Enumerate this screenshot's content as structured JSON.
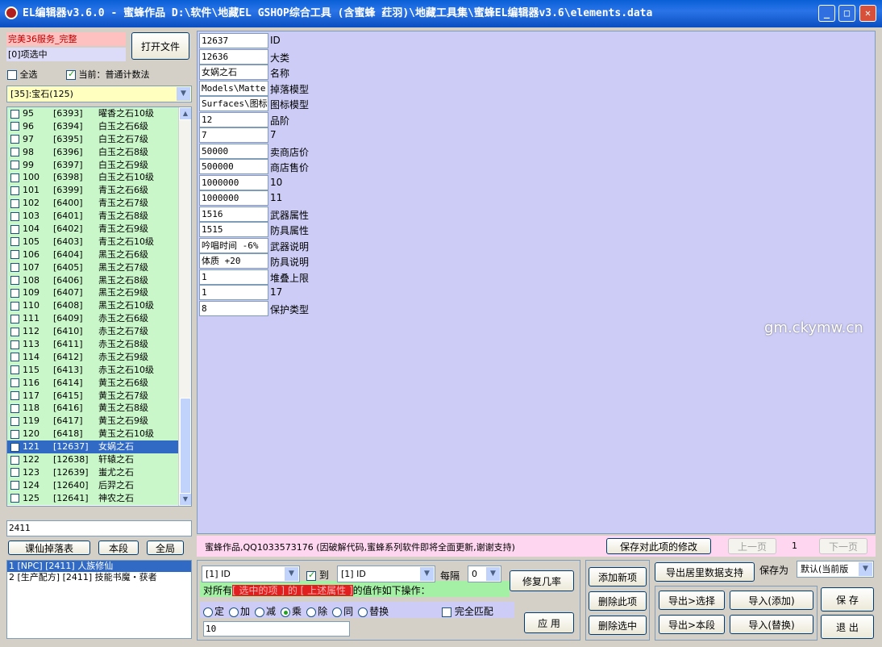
{
  "window": {
    "title": "EL编辑器v3.6.0  -  蜜蜂作品  D:\\软件\\地藏EL GSHOP综合工具 (含蜜蜂 荭羽)\\地藏工具集\\蜜蜂EL编辑器v3.6\\elements.data"
  },
  "left": {
    "server_label": "完美36服务_完整",
    "selected_count": "[0]项选中",
    "open_button": "打开文件",
    "select_all": "全选",
    "current_label": "当前：普通计数法",
    "category": "[35]:宝石(125)",
    "items": [
      {
        "n": "95",
        "id": "[6393]",
        "name": "曜香之石10级",
        "sel": false
      },
      {
        "n": "96",
        "id": "[6394]",
        "name": "白玉之石6级",
        "sel": false
      },
      {
        "n": "97",
        "id": "[6395]",
        "name": "白玉之石7级",
        "sel": false
      },
      {
        "n": "98",
        "id": "[6396]",
        "name": "白玉之石8级",
        "sel": false
      },
      {
        "n": "99",
        "id": "[6397]",
        "name": "白玉之石9级",
        "sel": false
      },
      {
        "n": "100",
        "id": "[6398]",
        "name": "白玉之石10级",
        "sel": false
      },
      {
        "n": "101",
        "id": "[6399]",
        "name": "青玉之石6级",
        "sel": false
      },
      {
        "n": "102",
        "id": "[6400]",
        "name": "青玉之石7级",
        "sel": false
      },
      {
        "n": "103",
        "id": "[6401]",
        "name": "青玉之石8级",
        "sel": false
      },
      {
        "n": "104",
        "id": "[6402]",
        "name": "青玉之石9级",
        "sel": false
      },
      {
        "n": "105",
        "id": "[6403]",
        "name": "青玉之石10级",
        "sel": false
      },
      {
        "n": "106",
        "id": "[6404]",
        "name": "黑玉之石6级",
        "sel": false
      },
      {
        "n": "107",
        "id": "[6405]",
        "name": "黑玉之石7级",
        "sel": false
      },
      {
        "n": "108",
        "id": "[6406]",
        "name": "黑玉之石8级",
        "sel": false
      },
      {
        "n": "109",
        "id": "[6407]",
        "name": "黑玉之石9级",
        "sel": false
      },
      {
        "n": "110",
        "id": "[6408]",
        "name": "黑玉之石10级",
        "sel": false
      },
      {
        "n": "111",
        "id": "[6409]",
        "name": "赤玉之石6级",
        "sel": false
      },
      {
        "n": "112",
        "id": "[6410]",
        "name": "赤玉之石7级",
        "sel": false
      },
      {
        "n": "113",
        "id": "[6411]",
        "name": "赤玉之石8级",
        "sel": false
      },
      {
        "n": "114",
        "id": "[6412]",
        "name": "赤玉之石9级",
        "sel": false
      },
      {
        "n": "115",
        "id": "[6413]",
        "name": "赤玉之石10级",
        "sel": false
      },
      {
        "n": "116",
        "id": "[6414]",
        "name": "黄玉之石6级",
        "sel": false
      },
      {
        "n": "117",
        "id": "[6415]",
        "name": "黄玉之石7级",
        "sel": false
      },
      {
        "n": "118",
        "id": "[6416]",
        "name": "黄玉之石8级",
        "sel": false
      },
      {
        "n": "119",
        "id": "[6417]",
        "name": "黄玉之石9级",
        "sel": false
      },
      {
        "n": "120",
        "id": "[6418]",
        "name": "黄玉之石10级",
        "sel": false
      },
      {
        "n": "121",
        "id": "[12637]",
        "name": "女娲之石",
        "sel": true
      },
      {
        "n": "122",
        "id": "[12638]",
        "name": "轩辕之石",
        "sel": false
      },
      {
        "n": "123",
        "id": "[12639]",
        "name": "蚩尤之石",
        "sel": false
      },
      {
        "n": "124",
        "id": "[12640]",
        "name": "后羿之石",
        "sel": false
      },
      {
        "n": "125",
        "id": "[12641]",
        "name": "神农之石",
        "sel": false
      }
    ],
    "search_value": "2411",
    "btn_drop": "课仙掉落表",
    "btn_section": "本段",
    "btn_all": "全局",
    "results": [
      "1 [NPC] [2411] 人族修仙",
      "2 [生产配方] [2411] 技能书魔・获者"
    ]
  },
  "fields": [
    {
      "value": "12637",
      "label": "ID"
    },
    {
      "value": "12636",
      "label": "大类"
    },
    {
      "value": "女娲之石",
      "label": "名称"
    },
    {
      "value": "Models\\Matte",
      "label": "掉落模型"
    },
    {
      "value": "Surfaces\\图标",
      "label": "图标模型"
    },
    {
      "value": "12",
      "label": "品阶"
    },
    {
      "value": "7",
      "label": "7"
    },
    {
      "value": "50000",
      "label": "卖商店价"
    },
    {
      "value": "500000",
      "label": "商店售价"
    },
    {
      "value": "1000000",
      "label": "10"
    },
    {
      "value": "1000000",
      "label": "11"
    },
    {
      "value": "1516",
      "label": "武器属性"
    },
    {
      "value": "1515",
      "label": "防具属性"
    },
    {
      "value": "吟唱时间 -6%",
      "label": "武器说明"
    },
    {
      "value": "体质 +20",
      "label": "防具说明"
    },
    {
      "value": "1",
      "label": "堆叠上限"
    },
    {
      "value": "1",
      "label": "17"
    },
    {
      "value": "8",
      "label": "保护类型"
    }
  ],
  "status": {
    "message": "蜜蜂作品,QQ1033573176 (因破解代码,蜜蜂系列软件即将全面更新,谢谢支持)",
    "save_item": "保存对此项的修改",
    "prev": "上一页",
    "page": "1",
    "next": "下一页"
  },
  "bottom": {
    "from_field": "[1] ID",
    "to_label": "到",
    "to_field": "[1] ID",
    "interval_label": "每隔",
    "interval_value": "0",
    "restore_btn": "修复几率",
    "text_prefix": "对所有",
    "highlight": "[ 选中的项 ] 的 [ 上述属性 ]",
    "text_suffix": "的值作如下操作：",
    "ops": [
      "定",
      "加",
      "减",
      "乘",
      "除",
      "同",
      "替换"
    ],
    "exact": "完全匹配",
    "apply": "应 用",
    "value_input": "10",
    "add_new": "添加新项",
    "delete_this": "删除此项",
    "delete_selected": "删除选中",
    "export_support": "导出居里数据支持",
    "export_selected": "导出>选择",
    "export_section": "导出>本段",
    "import_add": "导入(添加)",
    "import_replace": "导入(替换)",
    "save_as_label": "保存为",
    "save_as_value": "默认(当前版",
    "save": "保 存",
    "exit": "退 出"
  },
  "watermark": "gm.ckymw.cn"
}
